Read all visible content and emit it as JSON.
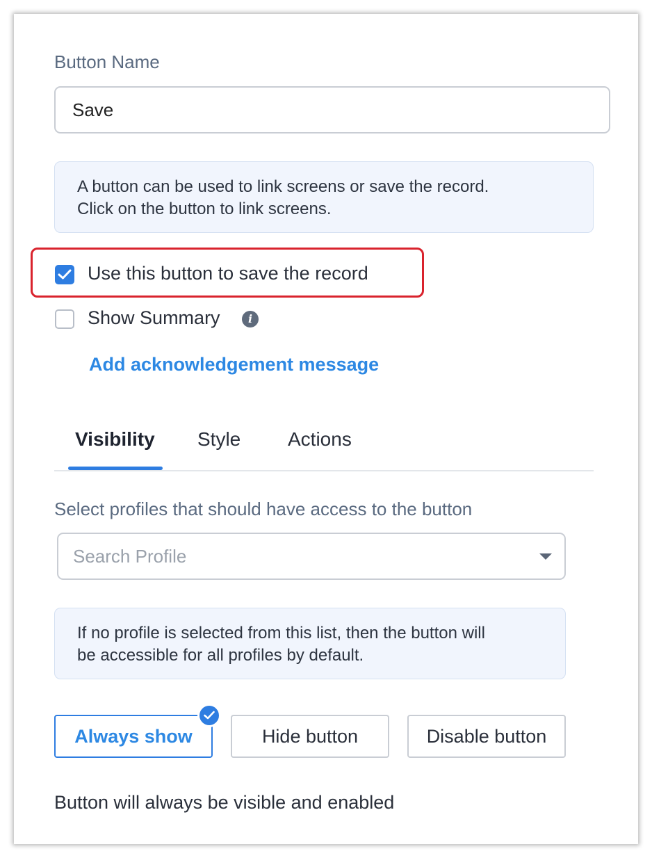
{
  "button_name": {
    "label": "Button Name",
    "value": "Save"
  },
  "info_link": {
    "line1": "A button can be used to link screens or save the record.",
    "line2": "Click on the button to link screens."
  },
  "options": {
    "save_record": {
      "label": "Use this button to save the record",
      "checked": true
    },
    "show_summary": {
      "label": "Show Summary",
      "checked": false,
      "info_icon": "info-icon"
    },
    "ack_link": "Add acknowledgement message"
  },
  "tabs": [
    {
      "label": "Visibility",
      "active": true
    },
    {
      "label": "Style",
      "active": false
    },
    {
      "label": "Actions",
      "active": false
    }
  ],
  "visibility": {
    "profile_label": "Select profiles that should have access to the button",
    "search_placeholder": "Search Profile",
    "note_line1": "If no profile is selected from this list, then the button will",
    "note_line2": "be accessible for all profiles by default.",
    "buttons": [
      {
        "label": "Always show",
        "selected": true
      },
      {
        "label": "Hide button",
        "selected": false
      },
      {
        "label": "Disable button",
        "selected": false
      }
    ],
    "description": "Button will always be visible and enabled"
  },
  "colors": {
    "accent": "#2e7de1",
    "link": "#2d88e3",
    "highlight_border": "#d9232d",
    "info_bg": "#f1f5fd"
  }
}
